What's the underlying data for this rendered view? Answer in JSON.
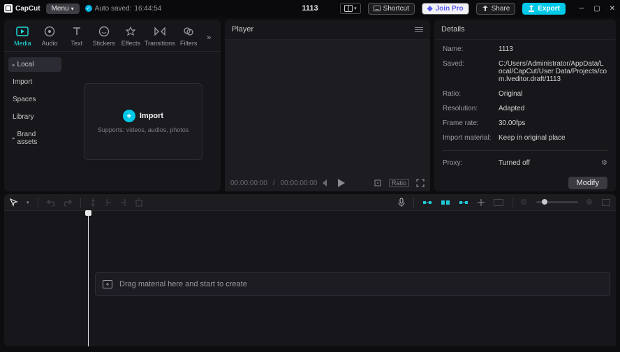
{
  "titlebar": {
    "brand": "CapCut",
    "menu_label": "Menu",
    "autosave_label": "Auto saved:",
    "autosave_time": "16:44:54",
    "project_name": "1113",
    "shortcut_label": "Shortcut",
    "join_pro_label": "Join Pro",
    "share_label": "Share",
    "export_label": "Export"
  },
  "top_tabs": {
    "items": [
      {
        "label": "Media"
      },
      {
        "label": "Audio"
      },
      {
        "label": "Text"
      },
      {
        "label": "Stickers"
      },
      {
        "label": "Effects"
      },
      {
        "label": "Transitions"
      },
      {
        "label": "Filters"
      }
    ]
  },
  "sidebar": {
    "items": [
      {
        "label": "Local",
        "expandable": true
      },
      {
        "label": "Import"
      },
      {
        "label": "Spaces"
      },
      {
        "label": "Library"
      },
      {
        "label": "Brand assets",
        "expandable": true
      }
    ]
  },
  "importer": {
    "title": "Import",
    "sub": "Supports: videos, audios, photos"
  },
  "player": {
    "title": "Player",
    "time_current": "00:00:00:00",
    "time_divider": " / ",
    "time_total": "00:00:00:00",
    "ratio_chip": "Ratio"
  },
  "details": {
    "title": "Details",
    "rows": {
      "name_label": "Name:",
      "name_val": "1113",
      "saved_label": "Saved:",
      "saved_val": "C:/Users/Administrator/AppData/Local/CapCut/User Data/Projects/com.lveditor.draft/1113",
      "ratio_label": "Ratio:",
      "ratio_val": "Original",
      "res_label": "Resolution:",
      "res_val": "Adapted",
      "fps_label": "Frame rate:",
      "fps_val": "30.00fps",
      "import_label": "Import material:",
      "import_val": "Keep in original place",
      "proxy_label": "Proxy:",
      "proxy_val": "Turned off"
    },
    "modify_label": "Modify"
  },
  "timeline": {
    "drop_hint": "Drag material here and start to create"
  }
}
